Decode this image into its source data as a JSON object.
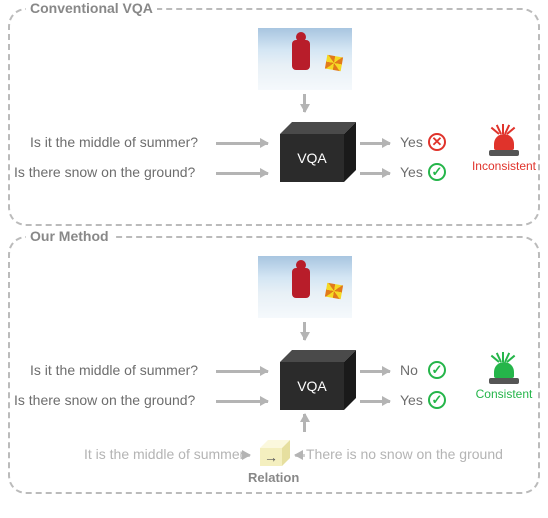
{
  "panel_a": {
    "title": "Conventional VQA",
    "vqa_label": "VQA",
    "q1": "Is it the middle of summer?",
    "q2": "Is there snow on the ground?",
    "a1": "Yes",
    "a2": "Yes",
    "siren_label": "Inconsistent"
  },
  "panel_b": {
    "title": "Our Method",
    "vqa_label": "VQA",
    "q1": "Is it the middle of summer?",
    "q2": "Is there snow on the ground?",
    "a1": "No",
    "a2": "Yes",
    "premise1": "It is the middle of summer",
    "premise2": "There is no snow on the ground",
    "relation_arrow": "→",
    "relation_label": "Relation",
    "siren_label": "Consistent"
  }
}
